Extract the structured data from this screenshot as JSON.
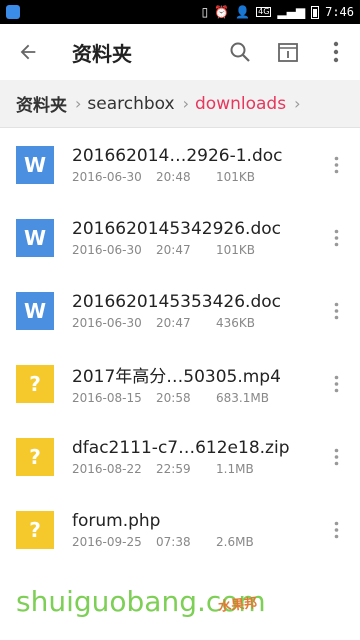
{
  "status_bar": {
    "network": "4G",
    "time": "7:46"
  },
  "toolbar": {
    "title": "资料夹"
  },
  "breadcrumb": {
    "items": [
      "资料夹",
      "searchbox",
      "downloads"
    ]
  },
  "files": [
    {
      "name": "201662014…2926-1.doc",
      "date": "2016-06-30",
      "time": "20:48",
      "size": "101KB",
      "type": "doc",
      "icon": "W"
    },
    {
      "name": "2016620145342926.doc",
      "date": "2016-06-30",
      "time": "20:47",
      "size": "101KB",
      "type": "doc",
      "icon": "W"
    },
    {
      "name": "2016620145353426.doc",
      "date": "2016-06-30",
      "time": "20:47",
      "size": "436KB",
      "type": "doc",
      "icon": "W"
    },
    {
      "name": "2017年高分…50305.mp4",
      "date": "2016-08-15",
      "time": "20:58",
      "size": "683.1MB",
      "type": "unknown",
      "icon": "?"
    },
    {
      "name": "dfac2111-c7…612e18.zip",
      "date": "2016-08-22",
      "time": "22:59",
      "size": "1.1MB",
      "type": "unknown",
      "icon": "?"
    },
    {
      "name": "forum.php",
      "date": "2016-09-25",
      "time": "07:38",
      "size": "2.6MB",
      "type": "unknown",
      "icon": "?"
    }
  ],
  "watermark": {
    "text": "shuiguobang.com",
    "cn": "水果邦"
  },
  "colors": {
    "doc_icon": "#4a8fe0",
    "unknown_icon": "#f5c92b",
    "breadcrumb_active": "#e8365d"
  }
}
